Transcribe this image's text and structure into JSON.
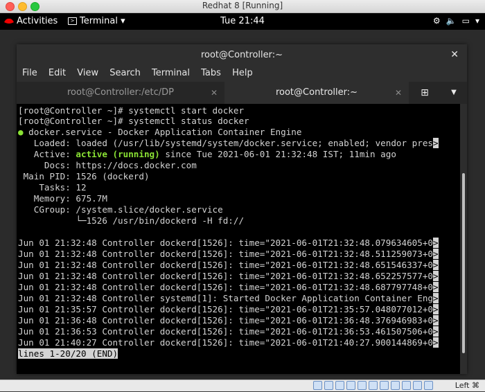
{
  "host_window": {
    "title": "Redhat 8  [Running]"
  },
  "gnome": {
    "activities": "Activities",
    "app_menu": "Terminal",
    "clock": "Tue 21:44",
    "network_icon": "network-icon",
    "volume_icon": "volume-icon",
    "battery_icon": "battery-icon"
  },
  "terminal": {
    "title": "root@Controller:~",
    "menu": [
      "File",
      "Edit",
      "View",
      "Search",
      "Terminal",
      "Tabs",
      "Help"
    ],
    "tabs": [
      {
        "label": "root@Controller:/etc/DP",
        "active": false
      },
      {
        "label": "root@Controller:~",
        "active": true
      }
    ],
    "lines": [
      "[root@Controller ~]# systemctl start docker",
      "[root@Controller ~]# systemctl status docker",
      " docker.service - Docker Application Container Engine",
      "   Loaded: loaded (/usr/lib/systemd/system/docker.service; enabled; vendor pres",
      "   Active: ",
      "     Docs: https://docs.docker.com",
      " Main PID: 1526 (dockerd)",
      "    Tasks: 12",
      "   Memory: 675.7M",
      "   CGroup: /system.slice/docker.service",
      "           └─1526 /usr/bin/dockerd -H fd://",
      "",
      "Jun 01 21:32:48 Controller dockerd[1526]: time=\"2021-06-01T21:32:48.079634605+0",
      "Jun 01 21:32:48 Controller dockerd[1526]: time=\"2021-06-01T21:32:48.511259073+0",
      "Jun 01 21:32:48 Controller dockerd[1526]: time=\"2021-06-01T21:32:48.651546337+0",
      "Jun 01 21:32:48 Controller dockerd[1526]: time=\"2021-06-01T21:32:48.652257577+0",
      "Jun 01 21:32:48 Controller dockerd[1526]: time=\"2021-06-01T21:32:48.687797748+0",
      "Jun 01 21:32:48 Controller systemd[1]: Started Docker Application Container Eng",
      "Jun 01 21:35:57 Controller dockerd[1526]: time=\"2021-06-01T21:35:57.048077012+0",
      "Jun 01 21:36:48 Controller dockerd[1526]: time=\"2021-06-01T21:36:48.376946983+0",
      "Jun 01 21:36:53 Controller dockerd[1526]: time=\"2021-06-01T21:36:53.461507506+0",
      "Jun 01 21:40:27 Controller dockerd[1526]: time=\"2021-06-01T21:40:27.900144869+0"
    ],
    "active_status": "active (running)",
    "active_rest": " since Tue 2021-06-01 21:32:48 IST; 11min ago",
    "status_dot": "●",
    "pager_status": "lines 1-20/20 (END)",
    "truncation_marker": ">"
  },
  "vbox": {
    "host_key": "Left ⌘"
  },
  "colors": {
    "accent": "#3584e4",
    "status_green": "#8ae234",
    "terminal_bg": "#000000"
  }
}
